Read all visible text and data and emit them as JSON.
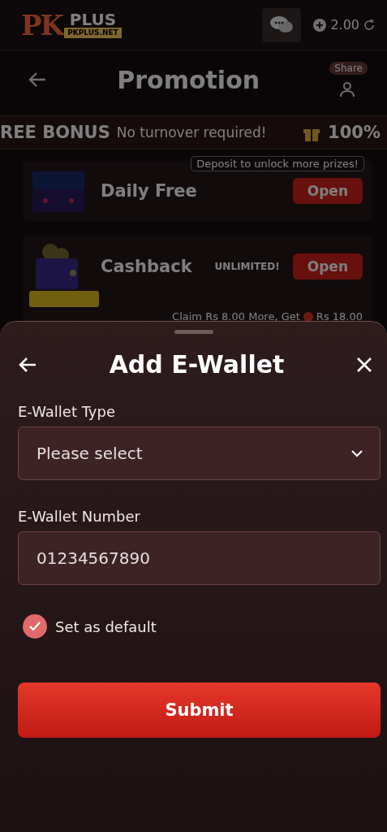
{
  "header": {
    "logo": {
      "mark": "PK",
      "word": "PLUS",
      "domain": "PKPLUS.NET"
    },
    "balance": "2.00"
  },
  "page": {
    "title": "Promotion",
    "share_label": "Share"
  },
  "banner": {
    "headline": "REE BONUS",
    "text": "No turnover required!",
    "percent": "100%"
  },
  "promotions": [
    {
      "kind": "chest",
      "title": "Daily Free",
      "note": "Deposit to unlock more prizes!",
      "button": "Open"
    },
    {
      "kind": "wallet",
      "title": "Cashback",
      "tag": "UNLIMITED!",
      "button": "Open",
      "claim": "Claim Rs 8.00 More, Get",
      "reward": "Rs 18.00"
    }
  ],
  "sheet": {
    "title": "Add E-Wallet",
    "fields": [
      {
        "kind": "select",
        "label": "E-Wallet Type",
        "placeholder": "Please select"
      },
      {
        "kind": "input",
        "label": "E-Wallet Number",
        "value": "01234567890"
      }
    ],
    "default_option": {
      "label": "Set as default",
      "checked": true
    },
    "submit": "Submit"
  }
}
